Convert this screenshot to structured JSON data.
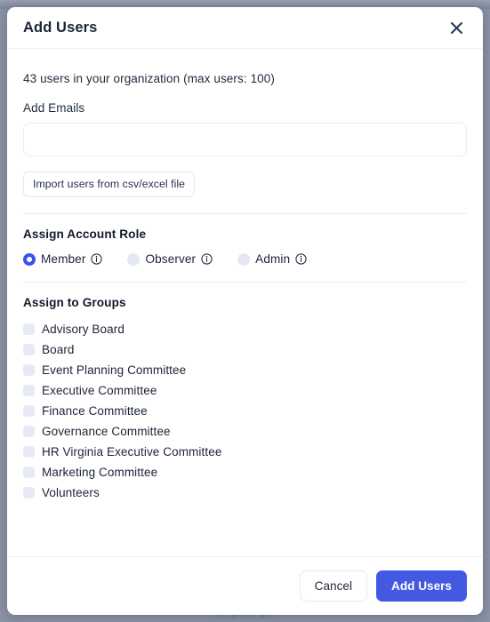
{
  "backdrop": {
    "behind_text": "No polls yet",
    "overlay_color": "#8b93a7"
  },
  "modal": {
    "title": "Add Users",
    "close_icon": "close-icon",
    "org_summary": "43 users in your organization (max users: 100)",
    "email_section": {
      "label": "Add Emails",
      "input_value": "",
      "input_placeholder": "",
      "import_button": "Import users from csv/excel file"
    },
    "role_section": {
      "title": "Assign Account Role",
      "info_icon": "info-icon",
      "options": [
        {
          "label": "Member",
          "selected": true
        },
        {
          "label": "Observer",
          "selected": false
        },
        {
          "label": "Admin",
          "selected": false
        }
      ]
    },
    "groups_section": {
      "title": "Assign to Groups",
      "items": [
        {
          "label": "Advisory Board",
          "checked": false
        },
        {
          "label": "Board",
          "checked": false
        },
        {
          "label": "Event Planning Committee",
          "checked": false
        },
        {
          "label": "Executive Committee",
          "checked": false
        },
        {
          "label": "Finance Committee",
          "checked": false
        },
        {
          "label": "Governance Committee",
          "checked": false
        },
        {
          "label": "HR Virginia Executive Committee",
          "checked": false
        },
        {
          "label": "Marketing Committee",
          "checked": false
        },
        {
          "label": "Volunteers",
          "checked": false
        }
      ]
    },
    "footer": {
      "cancel_label": "Cancel",
      "submit_label": "Add Users"
    }
  },
  "colors": {
    "accent": "#4359e2",
    "radio_selected": "#3b53e8",
    "control_idle": "#e4e8f2",
    "text": "#1b2436",
    "divider": "#e9ecf3"
  }
}
